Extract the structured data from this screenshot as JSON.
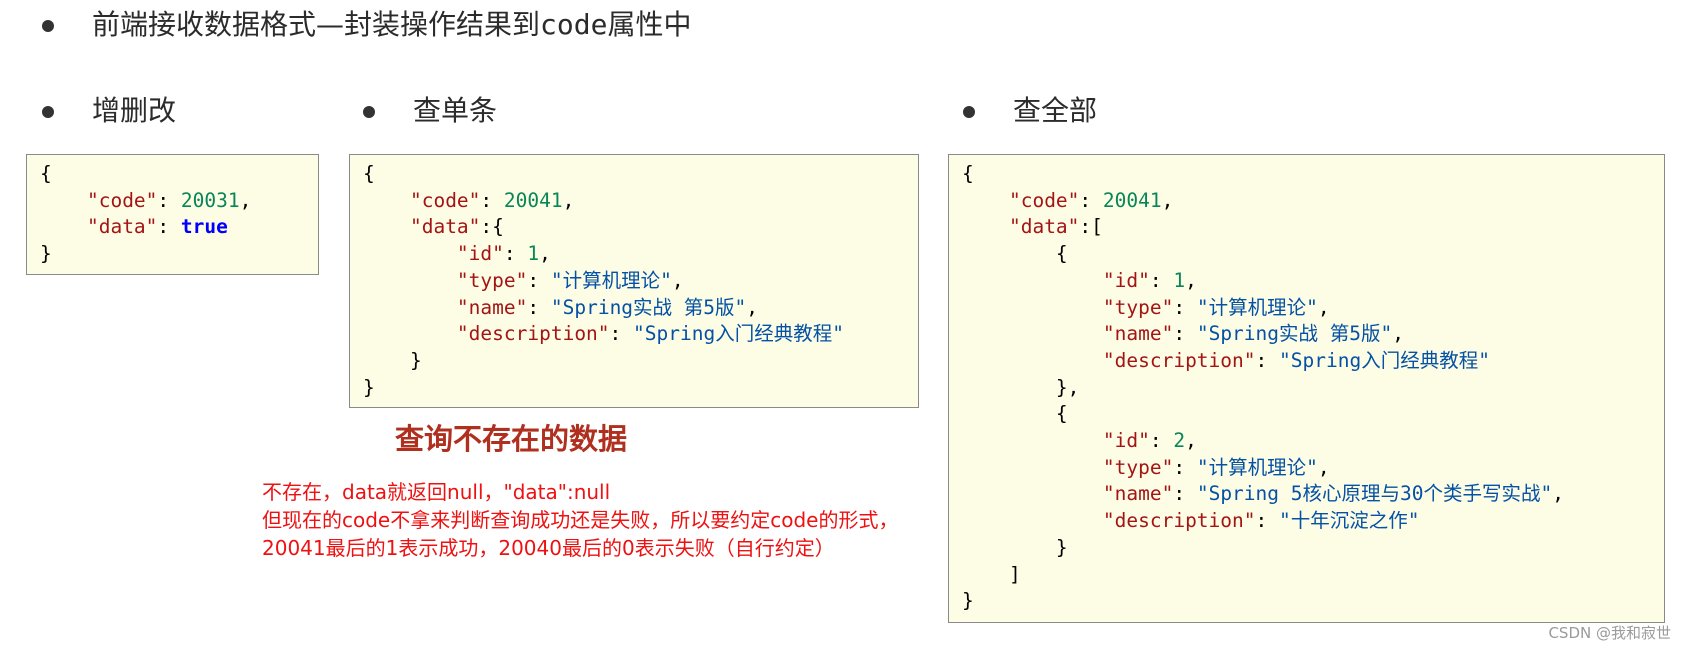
{
  "main_title": {
    "text_before": "前端接收数据格式—封装操作结果到",
    "text_mono": "code",
    "text_after": "属性中"
  },
  "sections": {
    "crud": {
      "title": "增删改",
      "code_value": "20031",
      "data_value": "true"
    },
    "single": {
      "title": "查单条",
      "code_value": "20041",
      "item": {
        "id": "1",
        "type": "计算机理论",
        "name": "Spring实战 第5版",
        "description": "Spring入门经典教程"
      }
    },
    "all": {
      "title": "查全部",
      "code_value": "20041",
      "items": [
        {
          "id": "1",
          "type": "计算机理论",
          "name": "Spring实战 第5版",
          "description": "Spring入门经典教程"
        },
        {
          "id": "2",
          "type": "计算机理论",
          "name": "Spring 5核心原理与30个类手写实战",
          "description": "十年沉淀之作"
        }
      ]
    }
  },
  "note": {
    "title": "查询不存在的数据",
    "lines": [
      "不存在，data就返回null，\"data\":null",
      "但现在的code不拿来判断查询成功还是失败，所以要约定code的形式，",
      "20041最后的1表示成功，20040最后的0表示失败（自行约定）"
    ]
  },
  "watermark": "CSDN @我和寂世"
}
